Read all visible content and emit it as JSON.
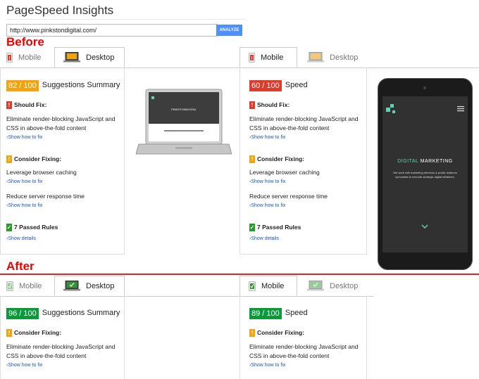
{
  "header": {
    "title": "PageSpeed Insights",
    "url_value": "http://www.pinkstondigital.com/",
    "analyze_label": "ANALYZE"
  },
  "labels": {
    "before": "Before",
    "after": "After"
  },
  "tabs": {
    "mobile": "Mobile",
    "desktop": "Desktop"
  },
  "before": {
    "desktop": {
      "score": "82 / 100",
      "score_label": "Suggestions Summary",
      "should_fix": "Should Fix:",
      "should_fix_item": "Eliminate render-blocking JavaScript and CSS in above-the-fold content",
      "should_fix_link": "Show how to fix",
      "consider": "Consider Fixing:",
      "item1": "Leverage browser caching",
      "item1_link": "Show how to fix",
      "item2": "Reduce server response time",
      "item2_link": "Show how to fix",
      "passed": "7 Passed Rules",
      "passed_link": "Show details"
    },
    "mobile": {
      "score": "60 / 100",
      "score_label": "Speed",
      "should_fix": "Should Fix:",
      "should_fix_item": "Eliminate render-blocking JavaScript and CSS in above-the-fold content",
      "should_fix_link": "Show how to fix",
      "consider": "Consider Fixing:",
      "item1": "Leverage browser caching",
      "item1_link": "Show how to fix",
      "item2": "Reduce server response time",
      "item2_link": "Show how to fix",
      "passed": "7 Passed Rules",
      "passed_link": "Show details"
    }
  },
  "after": {
    "desktop": {
      "score": "96 / 100",
      "score_label": "Suggestions Summary",
      "consider": "Consider Fixing:",
      "item1": "Eliminate render-blocking JavaScript and CSS in above-the-fold content",
      "item1_link": "Show how to fix"
    },
    "mobile": {
      "score": "89 / 100",
      "score_label": "Speed",
      "consider": "Consider Fixing:",
      "item1": "Eliminate render-blocking JavaScript and CSS in above-the-fold content",
      "item1_link": "Show how to fix"
    }
  },
  "preview": {
    "laptop_brand": "PINKSTONDIGITAL",
    "phone_heading_1": "DIGITAL",
    "phone_heading_2": "MARKETING",
    "phone_text": "We work with marketing directors & public relations specialists to execute strategic digital initiatives."
  },
  "colors": {
    "score_orange": "#f4a30d",
    "score_red": "#dd3b2c",
    "score_green": "#0a9a3a",
    "accent_blue": "#4d90fe",
    "before_after_red": "#e00000",
    "brand_teal": "#5fd3b3"
  }
}
